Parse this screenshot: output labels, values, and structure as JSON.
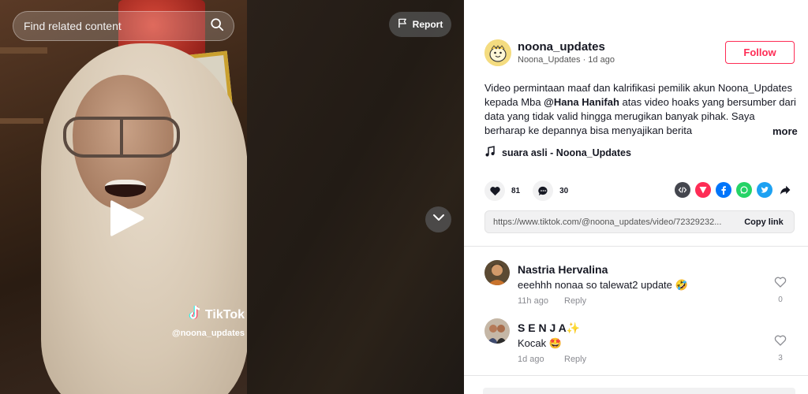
{
  "search": {
    "placeholder": "Find related content",
    "icon": "search-icon"
  },
  "video": {
    "report_label": "Report",
    "watermark_logo": "TikTok",
    "watermark_user": "@noona_updates"
  },
  "author": {
    "username": "noona_updates",
    "display_name": "Noona_Updates",
    "separator": " · ",
    "posted": "1d ago",
    "follow_label": "Follow"
  },
  "caption": {
    "text_before": "Video permintaan maaf dan kalrifikasi pemilik akun Noona_Updates kepada Mba ",
    "mention": "@Hana Hanifah",
    "text_after": " atas video hoaks yang bersumber dari data yang tidak valid hingga merugikan banyak pihak. Saya berharap ke depannya bisa menyajikan berita",
    "more_label": "more"
  },
  "music": {
    "label": "suara asli - Noona_Updates"
  },
  "stats": {
    "likes": "81",
    "comments": "30"
  },
  "share": {
    "icons": [
      "embed-icon",
      "send-to-friends-icon",
      "facebook-icon",
      "whatsapp-icon",
      "twitter-icon",
      "share-arrow-icon"
    ],
    "colors": {
      "embed": "#161823",
      "send": "#fe2c55",
      "facebook": "#0075fa",
      "whatsapp": "#25d366",
      "twitter": "#1da1f2"
    }
  },
  "link": {
    "url": "https://www.tiktok.com/@noona_updates/video/72329232...",
    "copy_label": "Copy link"
  },
  "comments": [
    {
      "name": "Nastria Hervalina",
      "text": "eeehhh nonaa so talewat2 update 🤣",
      "time": "11h ago",
      "reply": "Reply",
      "likes": "0"
    },
    {
      "name": "S E N J A✨",
      "text": "Kocak 🤩",
      "time": "1d ago",
      "reply": "Reply",
      "likes": "3"
    }
  ],
  "colors": {
    "accent": "#fe2c55",
    "text": "#161823",
    "muted": "#8a8b91"
  }
}
